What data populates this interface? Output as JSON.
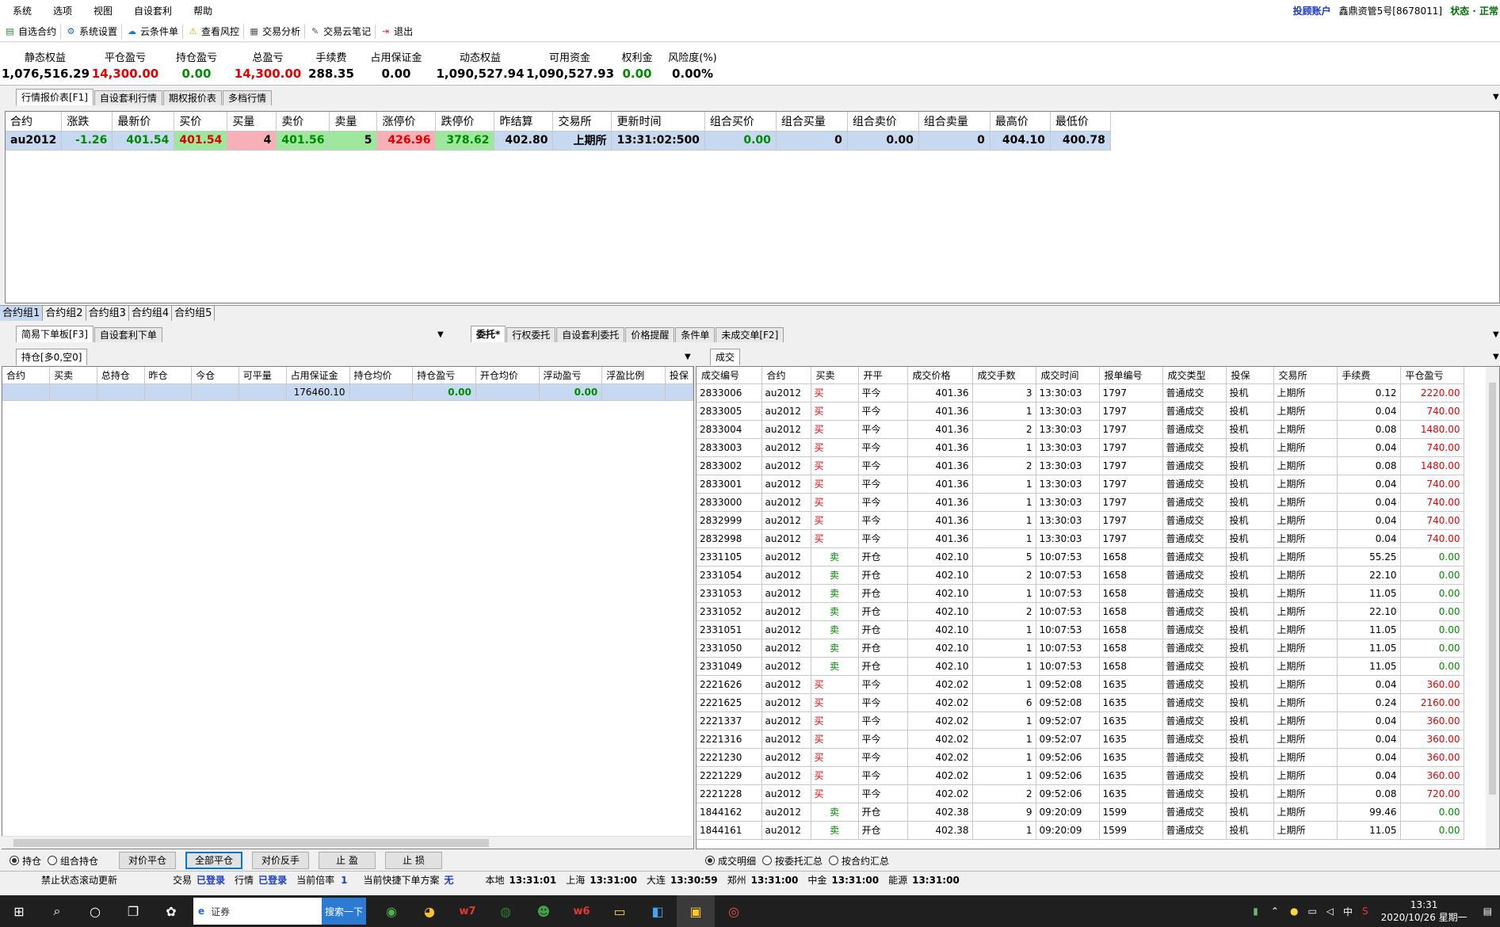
{
  "menu": [
    "系统",
    "选项",
    "视图",
    "自设套利",
    "帮助"
  ],
  "account": {
    "label": "投顾账户",
    "name": "鑫鼎资管5号[8678011]",
    "status": "状态 · 正常"
  },
  "toolbar": [
    {
      "icon": "watchlist-icon",
      "label": "自选合约"
    },
    {
      "icon": "gear-icon",
      "label": "系统设置"
    },
    {
      "icon": "cloud-icon",
      "label": "云条件单"
    },
    {
      "icon": "warning-icon",
      "label": "查看风控"
    },
    {
      "icon": "analysis-icon",
      "label": "交易分析"
    },
    {
      "icon": "notebook-icon",
      "label": "交易云笔记"
    },
    {
      "icon": "exit-icon",
      "label": "退出"
    }
  ],
  "summary": [
    {
      "label": "静态权益",
      "value": "1,076,516.29",
      "color": "#000000"
    },
    {
      "label": "平仓盈亏",
      "value": "14,300.00",
      "color": "#e00000"
    },
    {
      "label": "持仓盈亏",
      "value": "0.00",
      "color": "#008a00"
    },
    {
      "label": "总盈亏",
      "value": "14,300.00",
      "color": "#e00000"
    },
    {
      "label": "手续费",
      "value": "288.35",
      "color": "#000000"
    },
    {
      "label": "占用保证金",
      "value": "0.00",
      "color": "#000000"
    },
    {
      "label": "动态权益",
      "value": "1,090,527.94",
      "color": "#000000"
    },
    {
      "label": "可用资金",
      "value": "1,090,527.93",
      "color": "#000000"
    },
    {
      "label": "权利金",
      "value": "0.00",
      "color": "#008a00"
    },
    {
      "label": "风险度(%)",
      "value": "0.00%",
      "color": "#000000"
    }
  ],
  "quote_tabs": [
    "行情报价表[F1]",
    "自设套利行情",
    "期权报价表",
    "多档行情"
  ],
  "quote_table": {
    "headers": [
      "合约",
      "涨跌",
      "最新价",
      "买价",
      "买量",
      "卖价",
      "卖量",
      "涨停价",
      "跌停价",
      "昨结算",
      "交易所",
      "更新时间",
      "组合买价",
      "组合买量",
      "组合卖价",
      "组合卖量",
      "最高价",
      "最低价"
    ],
    "row": [
      "au2012",
      "-1.26",
      "401.54",
      "401.54",
      "4",
      "401.56",
      "5",
      "426.96",
      "378.62",
      "402.80",
      "上期所",
      "13:31:02:500",
      "0.00",
      "0",
      "0.00",
      "0",
      "404.10",
      "400.78"
    ]
  },
  "group_tabs": [
    "合约组1",
    "合约组2",
    "合约组3",
    "合约组4",
    "合约组5"
  ],
  "order_tabs_left": [
    "简易下单板[F3]",
    "自设套利下单"
  ],
  "order_tabs_right": [
    "委托*",
    "行权委托",
    "自设套利委托",
    "价格提醒",
    "条件单",
    "未成交单[F2]"
  ],
  "position_tab": "持仓[多0,空0]",
  "position_table": {
    "headers": [
      "合约",
      "买卖",
      "总持仓",
      "昨仓",
      "今仓",
      "可平量",
      "占用保证金",
      "持仓均价",
      "持仓盈亏",
      "开仓均价",
      "浮动盈亏",
      "浮盈比例",
      "投保"
    ],
    "row": [
      "",
      "",
      "",
      "",
      "",
      "",
      "176460.10",
      "",
      "0.00",
      "",
      "0.00",
      "",
      ""
    ]
  },
  "trade_tab": "成交",
  "trade_table": {
    "headers": [
      "成交编号",
      "合约",
      "买卖",
      "开平",
      "成交价格",
      "成交手数",
      "成交时间",
      "报单编号",
      "成交类型",
      "投保",
      "交易所",
      "手续费",
      "平仓盈亏"
    ],
    "rows": [
      [
        "2833006",
        "au2012",
        "买",
        "平今",
        "401.36",
        "3",
        "13:30:03",
        "1797",
        "普通成交",
        "投机",
        "上期所",
        "0.12",
        "2220.00"
      ],
      [
        "2833005",
        "au2012",
        "买",
        "平今",
        "401.36",
        "1",
        "13:30:03",
        "1797",
        "普通成交",
        "投机",
        "上期所",
        "0.04",
        "740.00"
      ],
      [
        "2833004",
        "au2012",
        "买",
        "平今",
        "401.36",
        "2",
        "13:30:03",
        "1797",
        "普通成交",
        "投机",
        "上期所",
        "0.08",
        "1480.00"
      ],
      [
        "2833003",
        "au2012",
        "买",
        "平今",
        "401.36",
        "1",
        "13:30:03",
        "1797",
        "普通成交",
        "投机",
        "上期所",
        "0.04",
        "740.00"
      ],
      [
        "2833002",
        "au2012",
        "买",
        "平今",
        "401.36",
        "2",
        "13:30:03",
        "1797",
        "普通成交",
        "投机",
        "上期所",
        "0.08",
        "1480.00"
      ],
      [
        "2833001",
        "au2012",
        "买",
        "平今",
        "401.36",
        "1",
        "13:30:03",
        "1797",
        "普通成交",
        "投机",
        "上期所",
        "0.04",
        "740.00"
      ],
      [
        "2833000",
        "au2012",
        "买",
        "平今",
        "401.36",
        "1",
        "13:30:03",
        "1797",
        "普通成交",
        "投机",
        "上期所",
        "0.04",
        "740.00"
      ],
      [
        "2832999",
        "au2012",
        "买",
        "平今",
        "401.36",
        "1",
        "13:30:03",
        "1797",
        "普通成交",
        "投机",
        "上期所",
        "0.04",
        "740.00"
      ],
      [
        "2832998",
        "au2012",
        "买",
        "平今",
        "401.36",
        "1",
        "13:30:03",
        "1797",
        "普通成交",
        "投机",
        "上期所",
        "0.04",
        "740.00"
      ],
      [
        "2331105",
        "au2012",
        "卖",
        "开仓",
        "402.10",
        "5",
        "10:07:53",
        "1658",
        "普通成交",
        "投机",
        "上期所",
        "55.25",
        "0.00"
      ],
      [
        "2331054",
        "au2012",
        "卖",
        "开仓",
        "402.10",
        "2",
        "10:07:53",
        "1658",
        "普通成交",
        "投机",
        "上期所",
        "22.10",
        "0.00"
      ],
      [
        "2331053",
        "au2012",
        "卖",
        "开仓",
        "402.10",
        "1",
        "10:07:53",
        "1658",
        "普通成交",
        "投机",
        "上期所",
        "11.05",
        "0.00"
      ],
      [
        "2331052",
        "au2012",
        "卖",
        "开仓",
        "402.10",
        "2",
        "10:07:53",
        "1658",
        "普通成交",
        "投机",
        "上期所",
        "22.10",
        "0.00"
      ],
      [
        "2331051",
        "au2012",
        "卖",
        "开仓",
        "402.10",
        "1",
        "10:07:53",
        "1658",
        "普通成交",
        "投机",
        "上期所",
        "11.05",
        "0.00"
      ],
      [
        "2331050",
        "au2012",
        "卖",
        "开仓",
        "402.10",
        "1",
        "10:07:53",
        "1658",
        "普通成交",
        "投机",
        "上期所",
        "11.05",
        "0.00"
      ],
      [
        "2331049",
        "au2012",
        "卖",
        "开仓",
        "402.10",
        "1",
        "10:07:53",
        "1658",
        "普通成交",
        "投机",
        "上期所",
        "11.05",
        "0.00"
      ],
      [
        "2221626",
        "au2012",
        "买",
        "平今",
        "402.02",
        "1",
        "09:52:08",
        "1635",
        "普通成交",
        "投机",
        "上期所",
        "0.04",
        "360.00"
      ],
      [
        "2221625",
        "au2012",
        "买",
        "平今",
        "402.02",
        "6",
        "09:52:08",
        "1635",
        "普通成交",
        "投机",
        "上期所",
        "0.24",
        "2160.00"
      ],
      [
        "2221337",
        "au2012",
        "买",
        "平今",
        "402.02",
        "1",
        "09:52:07",
        "1635",
        "普通成交",
        "投机",
        "上期所",
        "0.04",
        "360.00"
      ],
      [
        "2221316",
        "au2012",
        "买",
        "平今",
        "402.02",
        "1",
        "09:52:07",
        "1635",
        "普通成交",
        "投机",
        "上期所",
        "0.04",
        "360.00"
      ],
      [
        "2221230",
        "au2012",
        "买",
        "平今",
        "402.02",
        "1",
        "09:52:06",
        "1635",
        "普通成交",
        "投机",
        "上期所",
        "0.04",
        "360.00"
      ],
      [
        "2221229",
        "au2012",
        "买",
        "平今",
        "402.02",
        "1",
        "09:52:06",
        "1635",
        "普通成交",
        "投机",
        "上期所",
        "0.04",
        "360.00"
      ],
      [
        "2221228",
        "au2012",
        "买",
        "平今",
        "402.02",
        "2",
        "09:52:06",
        "1635",
        "普通成交",
        "投机",
        "上期所",
        "0.08",
        "720.00"
      ],
      [
        "1844162",
        "au2012",
        "卖",
        "开仓",
        "402.38",
        "9",
        "09:20:09",
        "1599",
        "普通成交",
        "投机",
        "上期所",
        "99.46",
        "0.00"
      ],
      [
        "1844161",
        "au2012",
        "卖",
        "开仓",
        "402.38",
        "1",
        "09:20:09",
        "1599",
        "普通成交",
        "投机",
        "上期所",
        "11.05",
        "0.00"
      ]
    ]
  },
  "position_controls": {
    "radio_hold": "持仓",
    "radio_combo": "组合持仓",
    "buttons": [
      "对价平仓",
      "全部平仓",
      "对价反手",
      "止 盈",
      "止 损"
    ]
  },
  "trade_controls": [
    "成交明细",
    "按委托汇总",
    "按合约汇总"
  ],
  "status": {
    "scroll": "禁止状态滚动更新",
    "trade_label": "交易",
    "trade_val": "已登录",
    "quote_label": "行情",
    "quote_val": "已登录",
    "mult_label": "当前倍率",
    "mult_val": "1",
    "plan_label": "当前快捷下单方案",
    "plan_val": "无",
    "clocks": [
      {
        "label": "本地",
        "time": "13:31:01"
      },
      {
        "label": "上海",
        "time": "13:31:00"
      },
      {
        "label": "大连",
        "time": "13:30:59"
      },
      {
        "label": "郑州",
        "time": "13:31:00"
      },
      {
        "label": "中金",
        "time": "13:31:00"
      },
      {
        "label": "能源",
        "time": "13:31:00"
      }
    ]
  },
  "taskbar": {
    "search_text": "证券",
    "search_button": "搜索一下",
    "time": "13:31",
    "date": "2020/10/26 星期一",
    "ime": "中"
  }
}
